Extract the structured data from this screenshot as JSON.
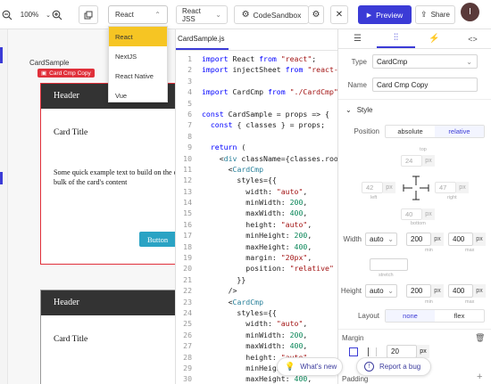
{
  "toolbar": {
    "zoom": "100%",
    "framework": "React",
    "styling": "React JSS",
    "codesandbox": "CodeSandbox",
    "preview": "Preview",
    "share": "Share",
    "avatar": "I"
  },
  "framework_menu": {
    "options": [
      "React",
      "NextJS",
      "React Native",
      "Vue"
    ],
    "selected": "React"
  },
  "canvas": {
    "frame_label": "CardSample",
    "selected_badge": "Card Cmp Copy",
    "card1": {
      "header": "Header",
      "title": "Card Title",
      "body": "Some quick example text to build on the card title and make up the bulk of the card's content",
      "button": "Button"
    },
    "card2": {
      "header": "Header",
      "title": "Card Title"
    }
  },
  "editor": {
    "tab": "CardSample.js",
    "lines": [
      "import React from \"react\";",
      "import injectSheet from \"react-jss\";",
      "",
      "import CardCmp from \"./CardCmp\";",
      "",
      "const CardSample = props => {",
      "  const { classes } = props;",
      "",
      "  return (",
      "    <div className={classes.root}>",
      "      <CardCmp",
      "        styles={{",
      "          width: \"auto\",",
      "          minWidth: 200,",
      "          maxWidth: 400,",
      "          height: \"auto\",",
      "          minHeight: 200,",
      "          maxHeight: 400,",
      "          margin: \"20px\",",
      "          position: \"relative\"",
      "        }}",
      "      />",
      "      <CardCmp",
      "        styles={{",
      "          width: \"auto\",",
      "          minWidth: 200,",
      "          maxWidth: 400,",
      "          height: \"auto\",",
      "          minHeight: 200,",
      "          maxHeight: 400,"
    ]
  },
  "panel": {
    "type_label": "Type",
    "type_value": "CardCmp",
    "name_label": "Name",
    "name_value": "Card Cmp Copy",
    "style_label": "Style",
    "position_label": "Position",
    "position_options": [
      "absolute",
      "relative"
    ],
    "position_selected": "relative",
    "top_label": "top",
    "top_value": "24",
    "left_label": "left",
    "left_value": "42",
    "right_label": "right",
    "right_value": "47",
    "bottom_label": "bottom",
    "bottom_value": "40",
    "unit": "px",
    "width_label": "Width",
    "width_mode": "auto",
    "width_min": "200",
    "width_max": "400",
    "min_label": "min",
    "max_label": "max",
    "stretch_label": "stretch",
    "height_label": "Height",
    "height_mode": "auto",
    "height_min": "200",
    "height_max": "400",
    "layout_label": "Layout",
    "layout_options": [
      "none",
      "flex"
    ],
    "layout_selected": "none",
    "margin_label": "Margin",
    "margin_value": "20",
    "padding_label": "Padding"
  },
  "help": {
    "whats_new": "What's new",
    "report_bug": "Report a bug"
  },
  "colors": {
    "accent": "#3b3bd6",
    "badge": "#e0303a",
    "teal_button": "#2aa3c4",
    "dropdown_selected": "#f6c523"
  }
}
